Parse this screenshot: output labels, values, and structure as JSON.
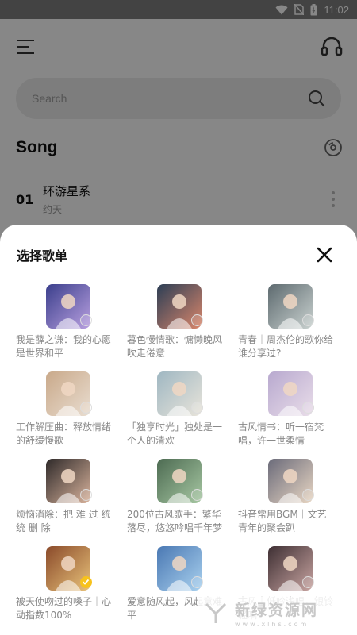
{
  "status_bar": {
    "time": "11:02"
  },
  "background": {
    "search_placeholder": "Search",
    "section_title": "Song",
    "song": {
      "index": "01",
      "title": "环游星系",
      "artist": "约天"
    }
  },
  "sheet": {
    "title": "选择歌单",
    "playlists": [
      {
        "label": "我是薛之谦：我的心愿是世界和平",
        "selected": false,
        "colors": [
          "#3b3f8c",
          "#b9a0e0"
        ]
      },
      {
        "label": "暮色慢情歌：慵懒晚风吹走倦意",
        "selected": false,
        "colors": [
          "#2c3e55",
          "#d9866b"
        ]
      },
      {
        "label": "青春｜周杰伦的歌你给谁分享过?",
        "selected": false,
        "colors": [
          "#5d6a6f",
          "#c9d1cf"
        ]
      },
      {
        "label": "工作解压曲：释放情绪的舒缓慢歌",
        "selected": false,
        "colors": [
          "#c9a98a",
          "#e9ddd0"
        ]
      },
      {
        "label": "「独享时光」独处是一个人的清欢",
        "selected": false,
        "colors": [
          "#9fb7c2",
          "#e8e4da"
        ]
      },
      {
        "label": "古风情书：听一宿梵唱，许一世柔情",
        "selected": false,
        "colors": [
          "#b8a9cf",
          "#e9dde9"
        ]
      },
      {
        "label": "烦恼消除：把 难 过 统统 删 除",
        "selected": false,
        "colors": [
          "#2f2a2a",
          "#d9b39c"
        ]
      },
      {
        "label": "200位古风歌手：繁华落尽，悠悠吟唱千年梦",
        "selected": false,
        "colors": [
          "#4d6b52",
          "#a6c7a2"
        ]
      },
      {
        "label": "抖音常用BGM｜文艺青年的聚会趴",
        "selected": false,
        "colors": [
          "#6b6b7a",
          "#e8d6c3"
        ]
      },
      {
        "label": "被天使吻过的嗓子｜心动指数100%",
        "selected": true,
        "colors": [
          "#8a4a2a",
          "#e8c27a"
        ]
      },
      {
        "label": "爱意随风起，风起意难平",
        "selected": false,
        "colors": [
          "#4a78b3",
          "#a8d0ee"
        ]
      },
      {
        "label": "古风｜低吟浅唱，银铃轻响",
        "selected": false,
        "colors": [
          "#3e2f33",
          "#c7a3a0"
        ]
      }
    ]
  },
  "watermark": {
    "main": "新绿资源网",
    "sub": "www.xlhs.com"
  },
  "colors": {
    "accent": "#f7c21d",
    "sheet_bg": "#ffffff"
  }
}
